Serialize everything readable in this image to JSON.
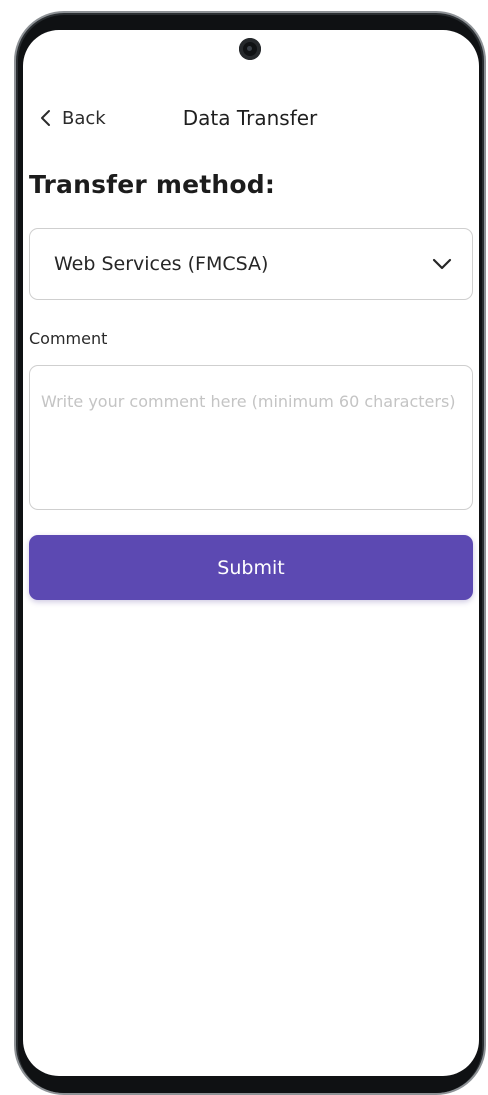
{
  "header": {
    "back_label": "Back",
    "title": "Data Transfer"
  },
  "transfer": {
    "heading": "Transfer method:",
    "selected_method": "Web Services (FMCSA)"
  },
  "comment": {
    "label": "Comment",
    "value": "",
    "placeholder": "Write your comment here (minimum 60 characters)"
  },
  "actions": {
    "submit_label": "Submit"
  },
  "icons": {
    "back": "chevron-left-icon",
    "dropdown": "chevron-down-icon"
  },
  "colors": {
    "accent": "#5c49b2",
    "frame": "#2a2e31",
    "text_primary": "#1c1c1c",
    "border": "#cfcfcf",
    "placeholder": "#c4c4c4"
  }
}
